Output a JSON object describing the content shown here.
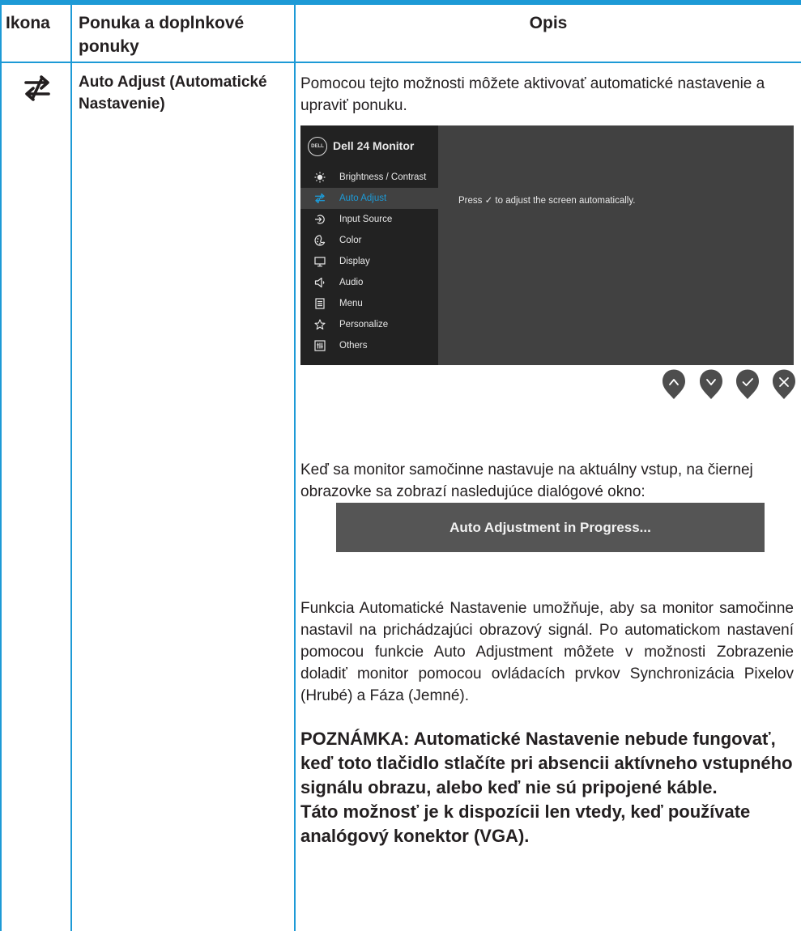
{
  "header": {
    "col_icon": "Ikona",
    "col_menu": "Ponuka a doplnkové ponuky",
    "col_desc": "Opis"
  },
  "row": {
    "icon": "auto-adjust-icon",
    "name": "Auto Adjust (Automatické Nastavenie)",
    "intro": "Pomocou tejto možnosti môžete aktivovať automatické nastavenie a upraviť ponuku.",
    "osd": {
      "logo": "DELL",
      "title": "Dell 24 Monitor",
      "items": [
        {
          "label": "Brightness / Contrast",
          "icon": "brightness-icon"
        },
        {
          "label": "Auto Adjust",
          "icon": "auto-adjust-icon",
          "selected": true
        },
        {
          "label": "Input Source",
          "icon": "input-source-icon"
        },
        {
          "label": "Color",
          "icon": "color-icon"
        },
        {
          "label": "Display",
          "icon": "display-icon"
        },
        {
          "label": "Audio",
          "icon": "audio-icon"
        },
        {
          "label": "Menu",
          "icon": "menu-icon"
        },
        {
          "label": "Personalize",
          "icon": "star-icon"
        },
        {
          "label": "Others",
          "icon": "others-icon"
        }
      ],
      "message": "Press ✓ to adjust the screen automatically.",
      "buttons": [
        "up-icon",
        "down-icon",
        "check-icon",
        "close-icon"
      ]
    },
    "para2": "Keď sa monitor samočinne nastavuje na aktuálny vstup, na čiernej obrazovke sa zobrazí nasledujúce dialógové okno:",
    "progress_text": "Auto Adjustment in Progress...",
    "para3": "Funkcia Automatické Nastavenie umožňuje, aby sa monitor samočinne nastavil na prichádzajúci obrazový signál. Po automatickom nastavení pomocou funkcie Auto Adjustment môžete v možnosti Zobrazenie doladiť monitor pomocou ovládacích prvkov Synchronizácia Pixelov (Hrubé) a Fáza (Jemné).",
    "note1": "POZNÁMKA: Automatické Nastavenie nebude fungovať, keď toto tlačidlo stlačíte pri absencii aktívneho vstupného signálu obrazu, alebo keď nie sú pripojené káble.",
    "note2": "Táto možnosť je k dispozícii len vtedy, keď používate analógový konektor (VGA)."
  },
  "colors": {
    "accent": "#1d9ad6",
    "osd_bg": "#414141",
    "osd_side": "#222222",
    "button": "#4d4d4d"
  }
}
